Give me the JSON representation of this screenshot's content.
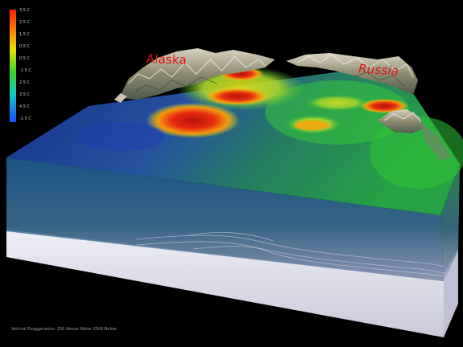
{
  "legend": {
    "ticks": [
      "3.5 C",
      "2.5 C",
      "1.5 C",
      "0.5 C",
      "0.5 C",
      "-1.5 C",
      "2.5 C",
      "3.5 C",
      "4.5 C",
      "-1.5 C"
    ]
  },
  "labels": {
    "alaska": "Alaska",
    "russia": "Russia"
  },
  "caption": "Vertical Exaggeration: 250 Above Water 2500 Below",
  "colors": {
    "background": "#000000",
    "label": "#e01414",
    "warm": "#e51b0e",
    "mid": "#29b52c",
    "cold": "#0e38b8",
    "base": "#dcdbe6"
  }
}
